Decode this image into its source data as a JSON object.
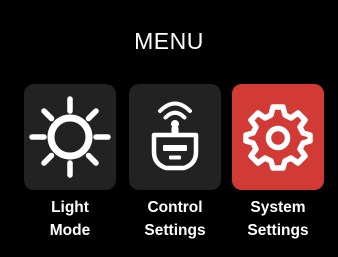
{
  "menu": {
    "title": "MENU",
    "items": [
      {
        "line1": "Light",
        "line2": "Mode",
        "icon": "sun-icon",
        "bg_color": "#222222",
        "selected": false
      },
      {
        "line1": "Control",
        "line2": "Settings",
        "icon": "remote-control-icon",
        "bg_color": "#222222",
        "selected": false
      },
      {
        "line1": "System",
        "line2": "Settings",
        "icon": "gear-icon",
        "bg_color": "#d23a36",
        "selected": true
      }
    ]
  }
}
